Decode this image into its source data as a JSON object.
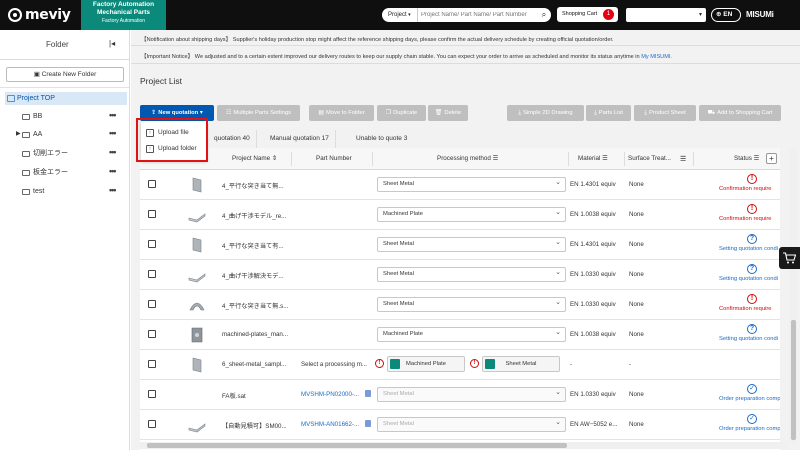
{
  "header": {
    "logo": "meviy",
    "product_line1": "Factory Automation",
    "product_line2": "Mechanical Parts",
    "product_line3": "Factory Automation",
    "search_scope": "Project",
    "search_placeholder": "Project Name/ Part Name/ Part Number",
    "cart_label": "Shopping Cart",
    "cart_count": "1",
    "lang": "EN",
    "brand": "MISUMi"
  },
  "sidebar": {
    "title": "Folder",
    "create_button": "Create New Folder",
    "top_label": "Project TOP",
    "items": [
      {
        "label": "BB",
        "has_children": false
      },
      {
        "label": "AA",
        "has_children": true
      },
      {
        "label": "切削エラー",
        "has_children": false
      },
      {
        "label": "板金エラー",
        "has_children": false
      },
      {
        "label": "test",
        "has_children": false
      }
    ]
  },
  "notices": [
    {
      "tag": "【Notification about shipping days】",
      "text": "Supplier's holiday production stop might affect the reference shipping days, please confirm the actual delivery schedule by creating official quotation/order.",
      "link": ""
    },
    {
      "tag": "【Important Notice】",
      "text": "We adjusted and to a certain extent improved our delivery routes to keep our supply chain stable. You can expect your order to arrive as scheduled and monitor its status anytime in",
      "link": "My MISUMI."
    }
  ],
  "project_list_title": "Project List",
  "toolbar": {
    "new_quotation": "New quotation",
    "multiple_parts": "Multiple Parts Settings",
    "move": "Move to Folder",
    "duplicate": "Duplicate",
    "delete": "Delete",
    "simple_2d": "Simple 2D Drawing",
    "parts_list": "Parts List",
    "product_sheet": "Product Sheet",
    "add_cart": "Add to Shopping Cart"
  },
  "dropdown": {
    "upload_file": "Upload file",
    "upload_folder": "Upload folder"
  },
  "tabs": {
    "auto_quotation": "quotation 40",
    "manual_quotation": "Manual quotation 17",
    "unable": "Unable to quote 3"
  },
  "columns": {
    "project_name": "Project Name ⇕",
    "part_number": "Part Number",
    "processing": "Processing method ☰",
    "material": "Material ☰",
    "surface": "Surface Treat...",
    "status": "Status ☰"
  },
  "rows": [
    {
      "name": "4_平行な突き当て無...",
      "part": "",
      "method": "Sheet Metal",
      "material": "EN 1.4301 equiv",
      "surface": "None",
      "status": "Confirmation require",
      "state": "err",
      "thumb": "sheet"
    },
    {
      "name": "4_曲げ干渉モデル_re...",
      "part": "",
      "method": "Machined Plate",
      "material": "EN 1.0038 equiv",
      "surface": "None",
      "status": "Confirmation require",
      "state": "err",
      "thumb": "bend"
    },
    {
      "name": "4_平行な突き当て有...",
      "part": "",
      "method": "Sheet Metal",
      "material": "EN 1.4301 equiv",
      "surface": "None",
      "status": "Setting quotation condi",
      "state": "q",
      "thumb": "sheet"
    },
    {
      "name": "4_曲げ干渉解決モデ...",
      "part": "",
      "method": "Sheet Metal",
      "material": "EN 1.0330 equiv",
      "surface": "None",
      "status": "Setting quotation condi",
      "state": "q",
      "thumb": "bend"
    },
    {
      "name": "4_平行な突き当て無.s...",
      "part": "",
      "method": "Sheet Metal",
      "material": "EN 1.0330 equiv",
      "surface": "None",
      "status": "Confirmation require",
      "state": "err",
      "thumb": "dome"
    },
    {
      "name": "machined-plates_man...",
      "part": "",
      "method": "Machined Plate",
      "material": "EN 1.0038 equiv",
      "surface": "None",
      "status": "Setting quotation condi",
      "state": "q",
      "thumb": "plate"
    },
    {
      "name": "6_sheet-metal_sampl...",
      "part": "Select a processing m...",
      "method": "",
      "material": "-",
      "surface": "-",
      "status": "",
      "state": "pick",
      "thumb": "sheet",
      "opt1": "Machined Plate",
      "opt2": "Sheet Metal"
    },
    {
      "name": "FA板.sat",
      "part": "MVSHM-PN02000-...",
      "method": "Sheet Metal",
      "material": "EN 1.0330 equiv",
      "surface": "None",
      "status": "Order preparation comp",
      "state": "ok",
      "thumb": "none"
    },
    {
      "name": "【自動見積可】SM00...",
      "part": "MVSHM-AN01662-...",
      "method": "Sheet Metal",
      "material": "EN AW−5052 e...",
      "surface": "None",
      "status": "Order preparation comp",
      "state": "ok",
      "thumb": "bend"
    }
  ]
}
